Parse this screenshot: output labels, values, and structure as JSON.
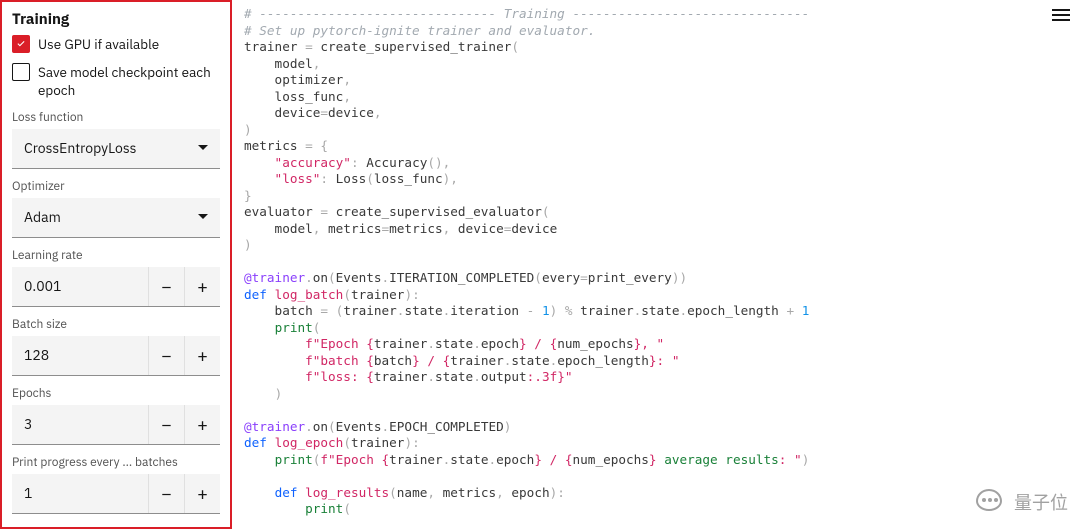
{
  "sidebar": {
    "title": "Training",
    "checkboxes": {
      "use_gpu": {
        "label": "Use GPU if available",
        "checked": true
      },
      "save_ckpt": {
        "label": "Save model checkpoint each epoch",
        "checked": false
      }
    },
    "fields": {
      "loss": {
        "label": "Loss function",
        "value": "CrossEntropyLoss"
      },
      "optim": {
        "label": "Optimizer",
        "value": "Adam"
      },
      "lr": {
        "label": "Learning rate",
        "value": "0.001"
      },
      "batch": {
        "label": "Batch size",
        "value": "128"
      },
      "epochs": {
        "label": "Epochs",
        "value": "3"
      },
      "print": {
        "label": "Print progress every ... batches",
        "value": "1"
      }
    }
  },
  "watermark_text": "量子位",
  "code_tokens": [
    [
      [
        "c",
        "# ------------------------------- Training -------------------------------"
      ]
    ],
    [
      [
        "c",
        "# Set up pytorch-ignite trainer and evaluator."
      ]
    ],
    [
      [
        "id",
        "trainer "
      ],
      [
        "p",
        "="
      ],
      [
        "id",
        " create_supervised_trainer"
      ],
      [
        "p",
        "("
      ]
    ],
    [
      [
        "id",
        "    model"
      ],
      [
        "p",
        ","
      ]
    ],
    [
      [
        "id",
        "    optimizer"
      ],
      [
        "p",
        ","
      ]
    ],
    [
      [
        "id",
        "    loss_func"
      ],
      [
        "p",
        ","
      ]
    ],
    [
      [
        "id",
        "    device"
      ],
      [
        "p",
        "="
      ],
      [
        "id",
        "device"
      ],
      [
        "p",
        ","
      ]
    ],
    [
      [
        "p",
        ")"
      ]
    ],
    [
      [
        "id",
        "metrics "
      ],
      [
        "p",
        "= {"
      ]
    ],
    [
      [
        "s",
        "    \"accuracy\""
      ],
      [
        "p",
        ": "
      ],
      [
        "id",
        "Accuracy"
      ],
      [
        "p",
        "(),"
      ]
    ],
    [
      [
        "s",
        "    \"loss\""
      ],
      [
        "p",
        ": "
      ],
      [
        "id",
        "Loss"
      ],
      [
        "p",
        "("
      ],
      [
        "id",
        "loss_func"
      ],
      [
        "p",
        "),"
      ]
    ],
    [
      [
        "p",
        "}"
      ]
    ],
    [
      [
        "id",
        "evaluator "
      ],
      [
        "p",
        "= "
      ],
      [
        "id",
        "create_supervised_evaluator"
      ],
      [
        "p",
        "("
      ]
    ],
    [
      [
        "id",
        "    model"
      ],
      [
        "p",
        ", "
      ],
      [
        "id",
        "metrics"
      ],
      [
        "p",
        "="
      ],
      [
        "id",
        "metrics"
      ],
      [
        "p",
        ", "
      ],
      [
        "id",
        "device"
      ],
      [
        "p",
        "="
      ],
      [
        "id",
        "device"
      ]
    ],
    [
      [
        "p",
        ")"
      ]
    ],
    [
      [
        "id",
        " "
      ]
    ],
    [
      [
        "d",
        "@trainer"
      ],
      [
        "p",
        "."
      ],
      [
        "id",
        "on"
      ],
      [
        "p",
        "("
      ],
      [
        "id",
        "Events"
      ],
      [
        "p",
        "."
      ],
      [
        "id",
        "ITERATION_COMPLETED"
      ],
      [
        "p",
        "("
      ],
      [
        "id",
        "every"
      ],
      [
        "p",
        "="
      ],
      [
        "id",
        "print_every"
      ],
      [
        "p",
        "))"
      ]
    ],
    [
      [
        "k",
        "def "
      ],
      [
        "fn",
        "log_batch"
      ],
      [
        "p",
        "("
      ],
      [
        "id",
        "trainer"
      ],
      [
        "p",
        "):"
      ]
    ],
    [
      [
        "id",
        "    batch "
      ],
      [
        "p",
        "= ("
      ],
      [
        "id",
        "trainer"
      ],
      [
        "p",
        "."
      ],
      [
        "id",
        "state"
      ],
      [
        "p",
        "."
      ],
      [
        "id",
        "iteration "
      ],
      [
        "p",
        "- "
      ],
      [
        "n",
        "1"
      ],
      [
        "p",
        ") % "
      ],
      [
        "id",
        "trainer"
      ],
      [
        "p",
        "."
      ],
      [
        "id",
        "state"
      ],
      [
        "p",
        "."
      ],
      [
        "id",
        "epoch_length "
      ],
      [
        "p",
        "+ "
      ],
      [
        "n",
        "1"
      ]
    ],
    [
      [
        "id",
        "    "
      ],
      [
        "pr",
        "print"
      ],
      [
        "p",
        "("
      ]
    ],
    [
      [
        "id",
        "        "
      ],
      [
        "s",
        "f\"Epoch {"
      ],
      [
        "id",
        "trainer"
      ],
      [
        "p",
        "."
      ],
      [
        "id",
        "state"
      ],
      [
        "p",
        "."
      ],
      [
        "id",
        "epoch"
      ],
      [
        "s",
        "} / {"
      ],
      [
        "id",
        "num_epochs"
      ],
      [
        "s",
        "}, \""
      ]
    ],
    [
      [
        "id",
        "        "
      ],
      [
        "s",
        "f\"batch {"
      ],
      [
        "id",
        "batch"
      ],
      [
        "s",
        "} / {"
      ],
      [
        "id",
        "trainer"
      ],
      [
        "p",
        "."
      ],
      [
        "id",
        "state"
      ],
      [
        "p",
        "."
      ],
      [
        "id",
        "epoch_length"
      ],
      [
        "s",
        "}: \""
      ]
    ],
    [
      [
        "id",
        "        "
      ],
      [
        "s",
        "f\"loss: {"
      ],
      [
        "id",
        "trainer"
      ],
      [
        "p",
        "."
      ],
      [
        "id",
        "state"
      ],
      [
        "p",
        "."
      ],
      [
        "id",
        "output"
      ],
      [
        "s",
        ":.3f}\""
      ]
    ],
    [
      [
        "id",
        "    "
      ],
      [
        "p",
        ")"
      ]
    ],
    [
      [
        "id",
        " "
      ]
    ],
    [
      [
        "d",
        "@trainer"
      ],
      [
        "p",
        "."
      ],
      [
        "id",
        "on"
      ],
      [
        "p",
        "("
      ],
      [
        "id",
        "Events"
      ],
      [
        "p",
        "."
      ],
      [
        "id",
        "EPOCH_COMPLETED"
      ],
      [
        "p",
        ")"
      ]
    ],
    [
      [
        "k",
        "def "
      ],
      [
        "fn",
        "log_epoch"
      ],
      [
        "p",
        "("
      ],
      [
        "id",
        "trainer"
      ],
      [
        "p",
        "):"
      ]
    ],
    [
      [
        "id",
        "    "
      ],
      [
        "pr",
        "print"
      ],
      [
        "p",
        "("
      ],
      [
        "s",
        "f\"Epoch {"
      ],
      [
        "id",
        "trainer"
      ],
      [
        "p",
        "."
      ],
      [
        "id",
        "state"
      ],
      [
        "p",
        "."
      ],
      [
        "id",
        "epoch"
      ],
      [
        "s",
        "} / {"
      ],
      [
        "id",
        "num_epochs"
      ],
      [
        "s",
        "} "
      ],
      [
        "pr",
        "average results"
      ],
      [
        "s",
        ": \""
      ],
      [
        "p",
        ")"
      ]
    ],
    [
      [
        "id",
        " "
      ]
    ],
    [
      [
        "id",
        "    "
      ],
      [
        "k",
        "def "
      ],
      [
        "fn",
        "log_results"
      ],
      [
        "p",
        "("
      ],
      [
        "id",
        "name"
      ],
      [
        "p",
        ", "
      ],
      [
        "id",
        "metrics"
      ],
      [
        "p",
        ", "
      ],
      [
        "id",
        "epoch"
      ],
      [
        "p",
        "):"
      ]
    ],
    [
      [
        "id",
        "        "
      ],
      [
        "pr",
        "print"
      ],
      [
        "p",
        "("
      ]
    ]
  ]
}
